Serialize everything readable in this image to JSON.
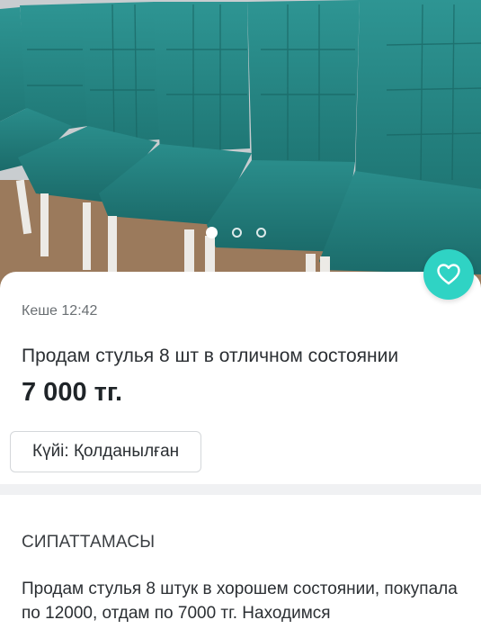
{
  "gallery": {
    "total_images": 3,
    "active_index": 0
  },
  "favorite": {
    "icon": "heart-icon",
    "color": "#2fd3c4"
  },
  "listing": {
    "timestamp": "Кеше 12:42",
    "title": "Продам стулья 8 шт в отличном состоянии",
    "price": "7 000 тг.",
    "condition_chip": "Күйі: Қолданылған"
  },
  "description": {
    "heading": "СИПАТТАМАСЫ",
    "text": "Продам стулья 8 штук в хорошем состоянии, покупала по 12000, отдам по 7000 тг. Находимся"
  },
  "colors": {
    "accent": "#2fd3c4",
    "chair_fabric": "#2a8c8a"
  }
}
